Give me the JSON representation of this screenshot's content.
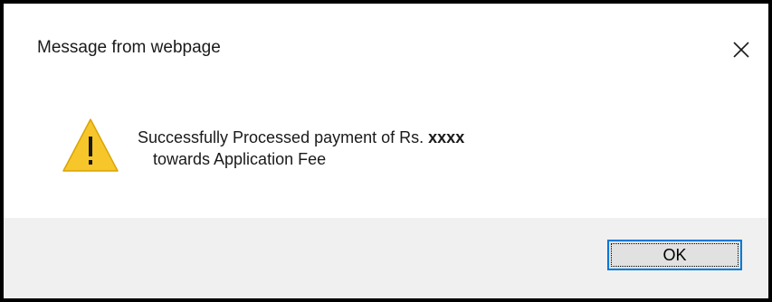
{
  "dialog": {
    "title": "Message from webpage",
    "icon": "warning-triangle-icon",
    "message": {
      "line1_text": "Successfully Processed payment of Rs.",
      "amount": "xxxx",
      "line2_text": "towards Application Fee"
    },
    "ok_label": "OK"
  },
  "colors": {
    "warning_yellow": "#f7c62b",
    "focus_border": "#0078d7",
    "footer_bg": "#f0f0f0",
    "button_bg": "#e1e1e1"
  }
}
